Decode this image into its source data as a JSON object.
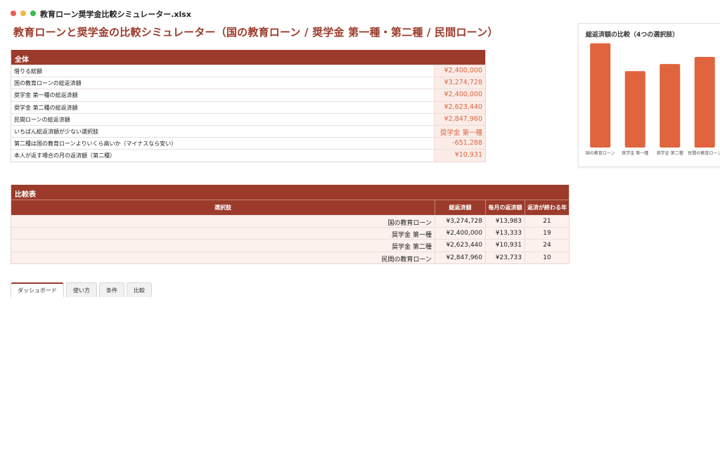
{
  "window": {
    "filename": "教育ローン奨学金比較シミュレーター.xlsx"
  },
  "sheet_title": "教育ローンと奨学金の比較シミュレーター（国の教育ローン / 奨学金 第一種・第二種 / 民間ローン）",
  "summary": {
    "header": "全体",
    "rows": [
      {
        "label": "借りる総額",
        "value": "¥2,400,000"
      },
      {
        "label": "国の教育ローンの総返済額",
        "value": "¥3,274,728"
      },
      {
        "label": "奨学金 第一種の総返済額",
        "value": "¥2,400,000"
      },
      {
        "label": "奨学金 第二種の総返済額",
        "value": "¥2,623,440"
      },
      {
        "label": "民間ローンの総返済額",
        "value": "¥2,847,960"
      },
      {
        "label": "いちばん総返済額が少ない選択肢",
        "value": "奨学金 第一種"
      },
      {
        "label": "第二種は国の教育ローンよりいくら高いか（マイナスなら安い）",
        "value": "-651,288"
      },
      {
        "label": "本人が返す場合の月の返済額（第二種）",
        "value": "¥10,931"
      }
    ]
  },
  "compare": {
    "header": "比較表",
    "columns": [
      "選択肢",
      "総返済額",
      "毎月の返済額",
      "返済が終わる年"
    ],
    "rows": [
      {
        "option": "国の教育ローン",
        "total": "¥3,274,728",
        "monthly": "¥13,983",
        "years": "21"
      },
      {
        "option": "奨学金 第一種",
        "total": "¥2,400,000",
        "monthly": "¥13,333",
        "years": "19"
      },
      {
        "option": "奨学金 第二種",
        "total": "¥2,623,440",
        "monthly": "¥10,931",
        "years": "24"
      },
      {
        "option": "民間の教育ローン",
        "total": "¥2,847,960",
        "monthly": "¥23,733",
        "years": "10"
      }
    ]
  },
  "tabs": [
    {
      "label": "ダッシュボード",
      "active": true
    },
    {
      "label": "使い方",
      "active": false
    },
    {
      "label": "条件",
      "active": false
    },
    {
      "label": "比較",
      "active": false
    }
  ],
  "colors": {
    "accent": "#9c3b2b",
    "bar": "#e0643d",
    "value_text": "#d9673e"
  },
  "chart_data": {
    "type": "bar",
    "title": "総返済額の比較（4つの選択肢）",
    "categories": [
      "国の教育ローン",
      "奨学金 第一種",
      "奨学金 第二種",
      "民間の教育ローン"
    ],
    "values": [
      3274728,
      2400000,
      2623440,
      2847960
    ],
    "xlabel": "",
    "ylabel": "",
    "ylim": [
      0,
      3400000
    ],
    "grid": false,
    "legend": "none"
  }
}
